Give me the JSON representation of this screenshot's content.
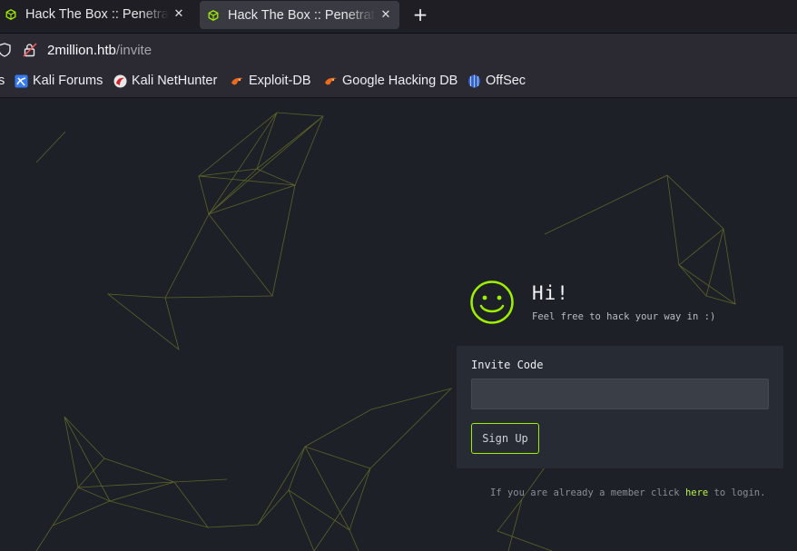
{
  "tabs": [
    {
      "title": "Hack The Box :: Penetration Testing Labs",
      "close": "✕"
    },
    {
      "title": "Hack The Box :: Penetration Testing Labs",
      "close": "✕"
    }
  ],
  "new_tab": "+",
  "urlbar": {
    "host": "2million.htb",
    "path": "/invite"
  },
  "bookmarks": [
    {
      "label": "s"
    },
    {
      "label": "Kali Forums"
    },
    {
      "label": "Kali NetHunter"
    },
    {
      "label": "Exploit-DB"
    },
    {
      "label": "Google Hacking DB"
    },
    {
      "label": "OffSec"
    }
  ],
  "page": {
    "greeting": "Hi!",
    "subtitle": "Feel free to hack your way in :)",
    "invite_label": "Invite Code",
    "invite_value": "",
    "signup_label": "Sign Up",
    "footer_before": "If you are already a member click ",
    "footer_link": "here",
    "footer_after": " to login."
  },
  "colors": {
    "accent": "#9fef00",
    "background": "#1d2127",
    "panel": "#272b33"
  }
}
